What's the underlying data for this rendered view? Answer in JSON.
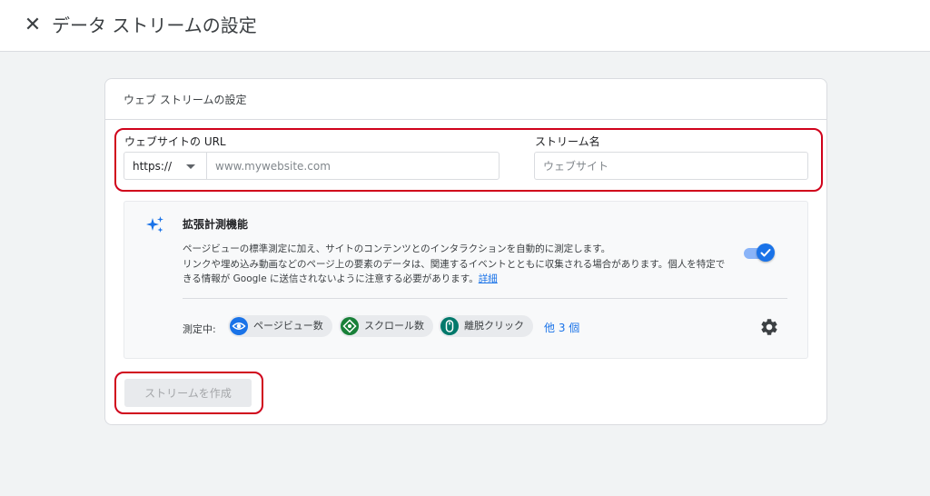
{
  "header": {
    "close_icon": "close-icon",
    "title": "データ ストリームの設定"
  },
  "card": {
    "title": "ウェブ ストリームの設定",
    "url_field": {
      "label": "ウェブサイトの URL",
      "protocol": "https://",
      "placeholder": "www.mywebsite.com",
      "value": ""
    },
    "stream_name": {
      "label": "ストリーム名",
      "placeholder": "ウェブサイト",
      "value": ""
    },
    "enhanced": {
      "icon": "sparkle-icon",
      "title": "拡張計測機能",
      "description_lines": [
        "ページビューの標準測定に加え、サイトのコンテンツとのインタラクションを自動的に測定します。",
        "リンクや埋め込み動画などのページ上の要素のデータは、関連するイベントとともに収集される場合があります。個人を特定で",
        "きる情報が Google に送信されないように注意する必要があります。"
      ],
      "detail_link": "詳細",
      "toggle_on": true,
      "measuring_label": "測定中:",
      "chips": [
        {
          "label": "ページビュー数",
          "icon": "eye-icon",
          "color": "#1a73e8"
        },
        {
          "label": "スクロール数",
          "icon": "scroll-target-icon",
          "color": "#188038"
        },
        {
          "label": "離脱クリック",
          "icon": "mouse-icon",
          "color": "#00796b"
        }
      ],
      "more_link": "他 3 個",
      "settings_icon": "gear-icon"
    },
    "create_button": "ストリームを作成"
  },
  "colors": {
    "highlight": "#d0021b",
    "accent": "#1a73e8"
  }
}
